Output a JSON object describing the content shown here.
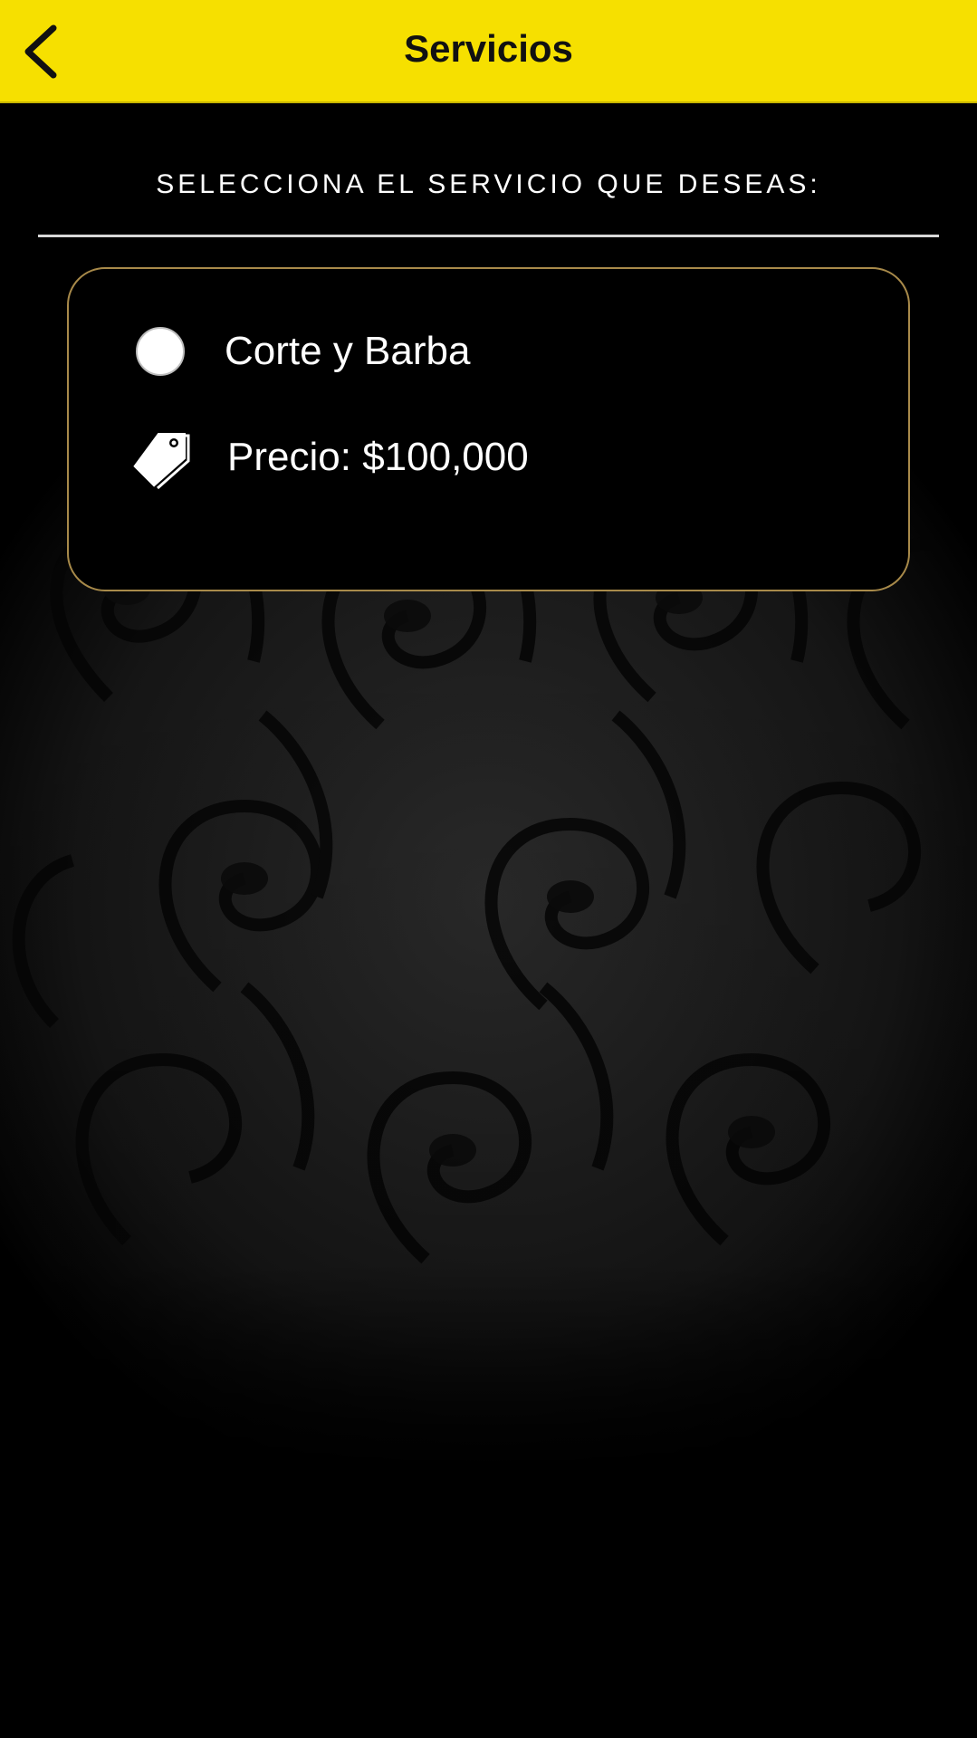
{
  "header": {
    "title": "Servicios",
    "back_icon": "chevron-left-icon",
    "background_color": "#f6e000"
  },
  "main": {
    "instruction": "SELECCIONA EL SERVICIO QUE DESEAS:",
    "services": [
      {
        "name": "Corte y Barba",
        "selected": false,
        "price_label": "Precio:",
        "price_value": "$100,000",
        "price_icon": "price-tag-icon"
      }
    ]
  },
  "colors": {
    "card_border": "#a88a4a",
    "background": "#000000",
    "text": "#ffffff"
  }
}
